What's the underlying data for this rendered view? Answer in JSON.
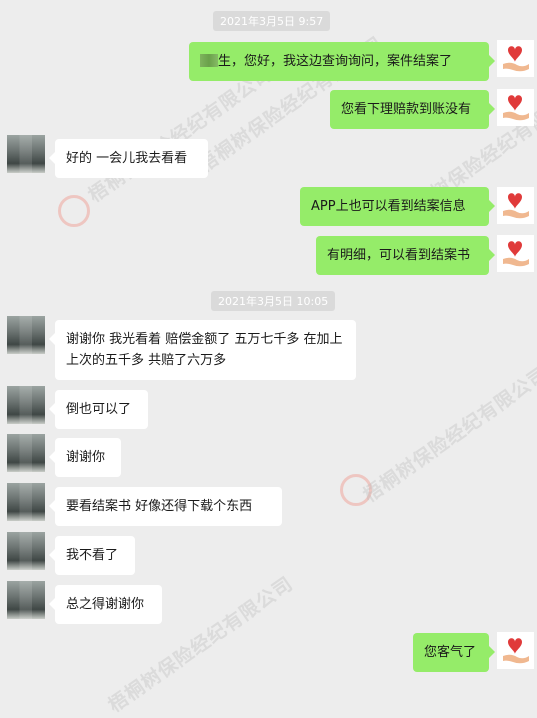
{
  "timestamps": [
    "2021年3月5日 9:57",
    "2021年3月5日 10:05"
  ],
  "watermark": "梧桐树保险经纪有限公司",
  "messages": [
    {
      "side": "right",
      "text": "生，您好，我这边查询询问，案件结案了"
    },
    {
      "side": "right",
      "text": "您看下理赔款到账没有"
    },
    {
      "side": "left",
      "text": "好的 一会儿我去看看"
    },
    {
      "side": "right",
      "text": "APP上也可以看到结案信息"
    },
    {
      "side": "right",
      "text": "有明细，可以看到结案书"
    },
    {
      "side": "left",
      "text": "谢谢你 我光看着 赔偿金额了 五万七千多 在加上上次的五千多 共赔了六万多"
    },
    {
      "side": "left",
      "text": "倒也可以了"
    },
    {
      "side": "left",
      "text": "谢谢你"
    },
    {
      "side": "left",
      "text": "要看结案书  好像还得下载个东西"
    },
    {
      "side": "left",
      "text": "我不看了"
    },
    {
      "side": "left",
      "text": "总之得谢谢你"
    },
    {
      "side": "right",
      "text": "您客气了"
    }
  ],
  "colors": {
    "background": "#ededed",
    "my_bubble": "#95ec69",
    "other_bubble": "#ffffff"
  },
  "icons": {
    "right_avatar": "heart-hand-icon",
    "left_avatar": "pixelated-avatar"
  }
}
